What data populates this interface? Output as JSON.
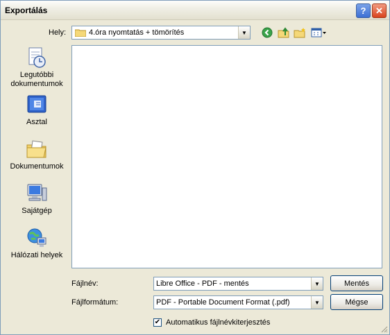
{
  "window": {
    "title": "Exportálás",
    "help_glyph": "?",
    "close_glyph": "✕"
  },
  "location": {
    "label": "Hely:",
    "value": "4.óra nyomtatás + tömörítés"
  },
  "toolbar": {
    "icons": [
      "back-icon",
      "up-folder-icon",
      "new-folder-icon",
      "view-menu-icon"
    ]
  },
  "places": [
    {
      "label": "Legutóbbi dokumentumok",
      "icon": "recent-documents-icon"
    },
    {
      "label": "Asztal",
      "icon": "desktop-icon"
    },
    {
      "label": "Dokumentumok",
      "icon": "my-documents-icon"
    },
    {
      "label": "Sajátgép",
      "icon": "my-computer-icon"
    },
    {
      "label": "Hálózati helyek",
      "icon": "network-places-icon"
    }
  ],
  "filename": {
    "label": "Fájlnév:",
    "value": "Libre Office - PDF - mentés"
  },
  "format": {
    "label": "Fájlformátum:",
    "value": "PDF - Portable Document Format (.pdf)"
  },
  "buttons": {
    "save": "Mentés",
    "cancel": "Mégse"
  },
  "auto_extension": {
    "label": "Automatikus fájlnévkiterjesztés",
    "checked": true
  }
}
